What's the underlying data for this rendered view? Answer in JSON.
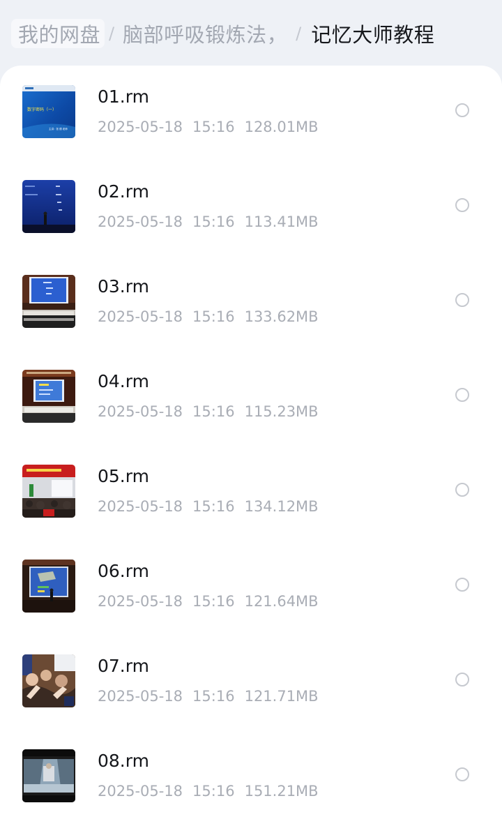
{
  "breadcrumb": {
    "items": [
      "我的网盘",
      "脑部呼吸锻炼法，",
      "记忆大师教程"
    ],
    "separator": "/"
  },
  "files": [
    {
      "name": "01.rm",
      "date": "2025-05-18",
      "time": "15:16",
      "size": "128.01MB",
      "thumb_title": "数字密码（一）",
      "thumb_caption": "主讲：张 德 老师"
    },
    {
      "name": "02.rm",
      "date": "2025-05-18",
      "time": "15:16",
      "size": "113.41MB"
    },
    {
      "name": "03.rm",
      "date": "2025-05-18",
      "time": "15:16",
      "size": "133.62MB"
    },
    {
      "name": "04.rm",
      "date": "2025-05-18",
      "time": "15:16",
      "size": "115.23MB"
    },
    {
      "name": "05.rm",
      "date": "2025-05-18",
      "time": "15:16",
      "size": "134.12MB"
    },
    {
      "name": "06.rm",
      "date": "2025-05-18",
      "time": "15:16",
      "size": "121.64MB"
    },
    {
      "name": "07.rm",
      "date": "2025-05-18",
      "time": "15:16",
      "size": "121.71MB"
    },
    {
      "name": "08.rm",
      "date": "2025-05-18",
      "time": "15:16",
      "size": "151.21MB"
    }
  ],
  "colors": {
    "background": "#eef1f6",
    "sheet": "#ffffff",
    "filename": "#14161a",
    "meta": "#a9adb5",
    "breadcrumb_muted": "#a3a8b2",
    "breadcrumb_current": "#16181c"
  },
  "icons": {
    "select": "radio-circle-icon"
  }
}
